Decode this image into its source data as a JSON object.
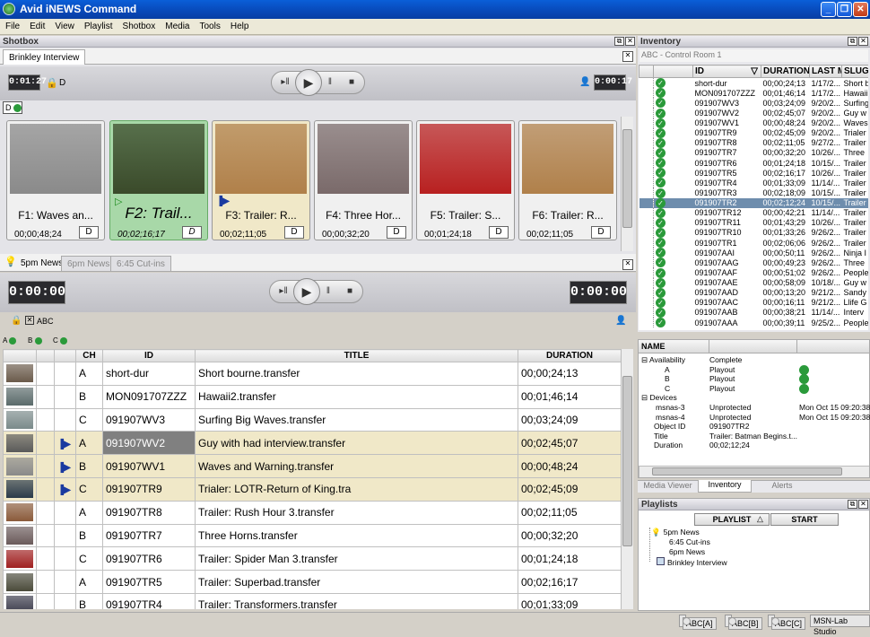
{
  "window": {
    "title": "Avid iNEWS Command"
  },
  "menu": [
    "File",
    "Edit",
    "View",
    "Playlist",
    "Shotbox",
    "Media",
    "Tools",
    "Help"
  ],
  "shotbox": {
    "header": "Shotbox",
    "tab": "Brinkley Interview",
    "time_left": "0:01:27",
    "time_right": "0:00:17",
    "lock_label": "D",
    "device_label": "D",
    "clips": [
      {
        "name": "F1: Waves an...",
        "dur": "00;00;48;24",
        "btn": "D",
        "color": "#8a8a8a",
        "state": "normal"
      },
      {
        "name": "F2: Trail...",
        "dur": "00;02;16;17",
        "btn": "D",
        "color": "#3a4a2a",
        "state": "playing"
      },
      {
        "name": "F3: Trailer: R...",
        "dur": "00;02;11;05",
        "btn": "D",
        "color": "#b0804a",
        "state": "cued"
      },
      {
        "name": "F4: Three Hor...",
        "dur": "00;00;32;20",
        "btn": "D",
        "color": "#7a6a6a",
        "state": "normal"
      },
      {
        "name": "F5: Trailer: S...",
        "dur": "00;01;24;18",
        "btn": "D",
        "color": "#b82020",
        "state": "normal"
      },
      {
        "name": "F6: Trailer: R...",
        "dur": "00;02;11;05",
        "btn": "D",
        "color": "#b0804a",
        "state": "normal"
      }
    ]
  },
  "rundown": {
    "tabs": [
      "5pm News",
      "6pm News",
      "6:45 Cut-ins"
    ],
    "time_left": "0:00:00",
    "time_right": "0:00:00",
    "lock_label": "ABC",
    "channels": [
      "A",
      "B",
      "C"
    ],
    "columns": {
      "ch": "CH",
      "id": "ID",
      "title": "TITLE",
      "duration": "DURATION"
    },
    "rows": [
      {
        "ch": "A",
        "id": "short-dur",
        "title": "Short bourne.transfer",
        "dur": "00;00;24;13",
        "cued": false,
        "color": "#6a5a4a"
      },
      {
        "ch": "B",
        "id": "MON091707ZZZ",
        "title": "Hawaii2.transfer",
        "dur": "00;01;46;14",
        "cued": false,
        "color": "#5a6a6a"
      },
      {
        "ch": "C",
        "id": "091907WV3",
        "title": "Surfing Big Waves.transfer",
        "dur": "00;03;24;09",
        "cued": false,
        "color": "#7a8a8a"
      },
      {
        "ch": "A",
        "id": "091907WV2",
        "title": "Guy with had interview.transfer",
        "dur": "00;02;45;07",
        "cued": true,
        "color": "#5a5a5a"
      },
      {
        "ch": "B",
        "id": "091907WV1",
        "title": "Waves and Warning.transfer",
        "dur": "00;00;48;24",
        "cued": true,
        "color": "#8a8a8a"
      },
      {
        "ch": "C",
        "id": "091907TR9",
        "title": "Trialer: LOTR-Return of King.tra",
        "dur": "00;02;45;09",
        "cued": true,
        "color": "#2a3a4a"
      },
      {
        "ch": "A",
        "id": "091907TR8",
        "title": "Trailer: Rush Hour 3.transfer",
        "dur": "00;02;11;05",
        "cued": false,
        "color": "#8a5a3a"
      },
      {
        "ch": "B",
        "id": "091907TR7",
        "title": "Three Horns.transfer",
        "dur": "00;00;32;20",
        "cued": false,
        "color": "#6a5a5a"
      },
      {
        "ch": "C",
        "id": "091907TR6",
        "title": "Trailer: Spider Man 3.transfer",
        "dur": "00;01;24;18",
        "cued": false,
        "color": "#a02020"
      },
      {
        "ch": "A",
        "id": "091907TR5",
        "title": "Trailer: Superbad.transfer",
        "dur": "00;02;16;17",
        "cued": false,
        "color": "#4a4a3a"
      },
      {
        "ch": "B",
        "id": "091907TR4",
        "title": "Trailer: Transformers.transfer",
        "dur": "00;01;33;09",
        "cued": false,
        "color": "#3a3a4a"
      }
    ]
  },
  "inventory": {
    "header": "Inventory",
    "source": "ABC - Control Room 1",
    "columns": {
      "id": "ID",
      "duration": "DURATION",
      "last": "LAST MO",
      "slug": "SLUG"
    },
    "rows": [
      [
        "short-dur",
        "00;00;24;13",
        "1/17/2...",
        "Short b"
      ],
      [
        "MON091707ZZZ",
        "00;01;46;14",
        "1/17/2...",
        "Hawaii"
      ],
      [
        "091907WV3",
        "00;03;24;09",
        "9/20/2...",
        "Surfing"
      ],
      [
        "091907WV2",
        "00;02;45;07",
        "9/20/2...",
        "Guy w"
      ],
      [
        "091907WV1",
        "00;00;48;24",
        "9/20/2...",
        "Waves"
      ],
      [
        "091907TR9",
        "00;02;45;09",
        "9/20/2...",
        "Trialer"
      ],
      [
        "091907TR8",
        "00;02;11;05",
        "9/27/2...",
        "Trailer"
      ],
      [
        "091907TR7",
        "00;00;32;20",
        "10/26/...",
        "Three"
      ],
      [
        "091907TR6",
        "00;01;24;18",
        "10/15/...",
        "Trailer"
      ],
      [
        "091907TR5",
        "00;02;16;17",
        "10/26/...",
        "Trailer"
      ],
      [
        "091907TR4",
        "00;01;33;09",
        "11/14/...",
        "Trailer"
      ],
      [
        "091907TR3",
        "00;02;18;09",
        "10/15/...",
        "Trailer"
      ],
      [
        "091907TR2",
        "00;02;12;24",
        "10/15/...",
        "Trailer"
      ],
      [
        "091907TR12",
        "00;00;42;21",
        "11/14/...",
        "Trailer"
      ],
      [
        "091907TR11",
        "00;01;43;29",
        "10/26/...",
        "Trailer"
      ],
      [
        "091907TR10",
        "00;01;33;26",
        "9/26/2...",
        "Trailer"
      ],
      [
        "091907TR1",
        "00;02;06;06",
        "9/26/2...",
        "Trailer"
      ],
      [
        "091907AAI",
        "00;00;50;11",
        "9/26/2...",
        "Ninja I"
      ],
      [
        "091907AAG",
        "00;00;49;23",
        "9/26/2...",
        "Three"
      ],
      [
        "091907AAF",
        "00;00;51;02",
        "9/26/2...",
        "People"
      ],
      [
        "091907AAE",
        "00;00;58;09",
        "10/18/...",
        "Guy w"
      ],
      [
        "091907AAD",
        "00;00;13;20",
        "9/21/2...",
        "Sandy"
      ],
      [
        "091907AAC",
        "00;00;16;11",
        "9/21/2...",
        "Llife G"
      ],
      [
        "091907AAB",
        "00;00;38;21",
        "11/14/...",
        "Interv"
      ],
      [
        "091907AAA",
        "00;00;39;11",
        "9/25/2...",
        "People"
      ]
    ],
    "selected_index": 12
  },
  "properties": {
    "col_name": "NAME",
    "availability": {
      "label": "Availability",
      "value": "Complete"
    },
    "channels": [
      {
        "name": "A",
        "value": "Playout"
      },
      {
        "name": "B",
        "value": "Playout"
      },
      {
        "name": "C",
        "value": "Playout"
      }
    ],
    "devices": {
      "label": "Devices",
      "items": [
        {
          "name": "msnas-3",
          "value": "Unprotected",
          "date": "Mon Oct 15 09:20:38"
        },
        {
          "name": "msnas-4",
          "value": "Unprotected",
          "date": "Mon Oct 15 09:20:38"
        }
      ]
    },
    "object_id": {
      "label": "Object ID",
      "value": "091907TR2"
    },
    "title": {
      "label": "Title",
      "value": "Trailer: Batman Begins.t..."
    },
    "duration": {
      "label": "Duration",
      "value": "00;02;12;24"
    }
  },
  "bottom_tabs": [
    "Media Viewer",
    "Inventory",
    "Alerts"
  ],
  "playlists": {
    "header": "Playlists",
    "col_playlist": "PLAYLIST",
    "col_start": "START",
    "items": [
      "5pm News",
      "6:45 Cut-ins",
      "6pm News",
      "Brinkley Interview"
    ]
  },
  "status": [
    "ABC[A]",
    "ABC[B]",
    "ABC[C]",
    "MSN-Lab Studio"
  ]
}
